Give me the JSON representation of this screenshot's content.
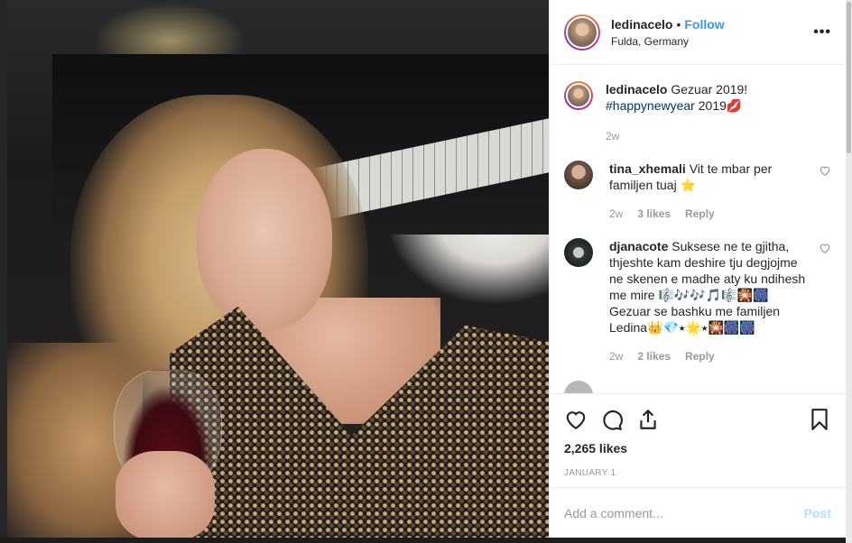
{
  "header": {
    "username": "ledinacelo",
    "separator": "•",
    "follow_label": "Follow",
    "location": "Fulda, Germany",
    "more_label": "•••"
  },
  "caption": {
    "username": "ledinacelo",
    "text": "Gezuar 2019!",
    "hashtag": "#happynewyear",
    "text_after": "2019💋",
    "time": "2w"
  },
  "comments": [
    {
      "username": "tina_xhemali",
      "text": "Vit te mbar per familjen tuaj ⭐",
      "time": "2w",
      "likes": "3 likes",
      "reply_label": "Reply"
    },
    {
      "username": "djanacote",
      "text": "Suksese ne te gjitha, thjeshte kam deshire tju degjojme ne skenen e madhe aty ku ndihesh me mire 🎼🎶🎶🎵🎼🎇🎆Gezuar se bashku me familjen Ledina👑💎⭑🌟⭑🎇🎆🎆",
      "time": "2w",
      "likes": "2 likes",
      "reply_label": "Reply"
    }
  ],
  "partial_comment": {
    "username": "",
    "text": ""
  },
  "actions": {
    "likes_count": "2,265 likes",
    "date": "JANUARY 1"
  },
  "add_comment": {
    "placeholder": "Add a comment...",
    "post_label": "Post"
  },
  "colors": {
    "follow": "#3897f0",
    "hashtag": "#003569",
    "post_disabled": "#b2dffc"
  }
}
